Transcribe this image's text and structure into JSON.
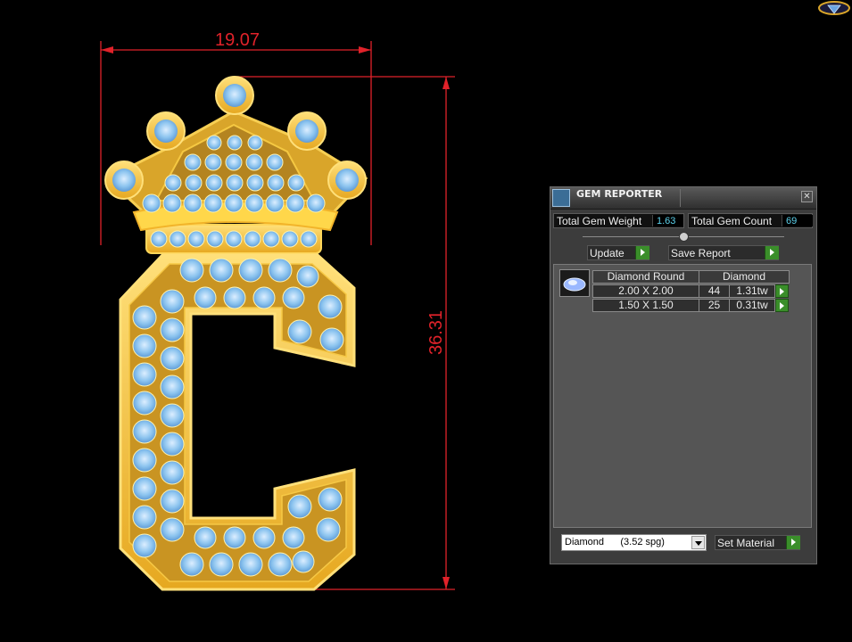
{
  "viewport": {
    "dimension_width": "19.07",
    "dimension_height": "36.31"
  },
  "gem_reporter": {
    "title": "GEM REPORTER",
    "close_icon": "close-icon",
    "total_gem_weight_label": "Total Gem Weight",
    "total_gem_weight_value": "1.63",
    "total_gem_count_label": "Total Gem Count",
    "total_gem_count_value": "69",
    "update_label": "Update",
    "save_report_label": "Save Report",
    "table": {
      "shape_header": "Diamond Round",
      "material_header": "Diamond",
      "rows": [
        {
          "size": "2.00 X 2.00",
          "count": "44",
          "weight": "1.31tw"
        },
        {
          "size": "1.50 X 1.50",
          "count": "25",
          "weight": "0.31tw"
        }
      ]
    },
    "material_select": {
      "value": "Diamond      (3.52 spg)"
    },
    "set_material_label": "Set Material"
  },
  "colors": {
    "background": "#000000",
    "dimension_line": "#e0222a",
    "gold": "#f2c032",
    "gem": "#8cc4ef",
    "panel": "#3c3c3c",
    "value_text": "#5bd0ea",
    "play_button": "#3a8e2a"
  }
}
